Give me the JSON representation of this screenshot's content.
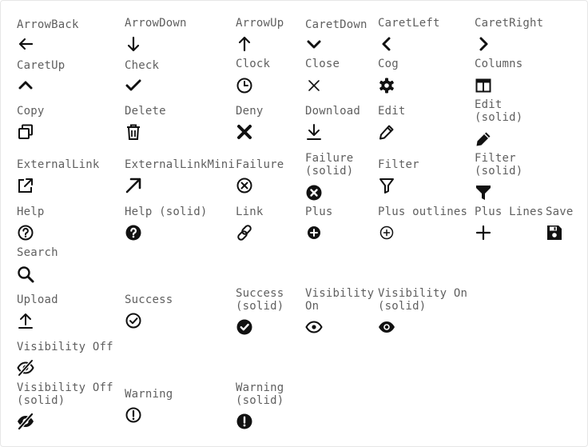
{
  "icons": [
    {
      "label": "ArrowBack",
      "icon": "arrow-back-icon"
    },
    {
      "label": "ArrowDown",
      "icon": "arrow-down-icon"
    },
    {
      "label": "ArrowUp",
      "icon": "arrow-up-icon"
    },
    {
      "label": "CaretDown",
      "icon": "caret-down-icon"
    },
    {
      "label": "CaretLeft",
      "icon": "caret-left-icon"
    },
    {
      "label": "CaretRight",
      "icon": "caret-right-icon"
    },
    {
      "label": "CaretUp",
      "icon": "caret-up-icon"
    },
    {
      "label": "Check",
      "icon": "check-icon"
    },
    {
      "label": "Clock",
      "icon": "clock-icon"
    },
    {
      "label": "Close",
      "icon": "close-icon"
    },
    {
      "label": "Cog",
      "icon": "cog-icon"
    },
    {
      "label": "Columns",
      "icon": "columns-icon"
    },
    {
      "label": "Copy",
      "icon": "copy-icon"
    },
    {
      "label": "Delete",
      "icon": "delete-icon"
    },
    {
      "label": "Deny",
      "icon": "deny-icon"
    },
    {
      "label": "Download",
      "icon": "download-icon"
    },
    {
      "label": "Edit",
      "icon": "edit-icon"
    },
    {
      "label": "Edit\n(solid)",
      "icon": "edit-solid-icon"
    },
    {
      "label": "ExternalLink",
      "icon": "external-link-icon"
    },
    {
      "label": "ExternalLinkMini",
      "icon": "external-link-mini-icon"
    },
    {
      "label": "Failure",
      "icon": "failure-icon"
    },
    {
      "label": "Failure\n(solid)",
      "icon": "failure-solid-icon"
    },
    {
      "label": "Filter",
      "icon": "filter-icon"
    },
    {
      "label": "Filter\n(solid)",
      "icon": "filter-solid-icon"
    },
    {
      "label": "Help",
      "icon": "help-icon"
    },
    {
      "label": "Help (solid)",
      "icon": "help-solid-icon"
    },
    {
      "label": "Link",
      "icon": "link-icon"
    },
    {
      "label": "Plus",
      "icon": "plus-icon"
    },
    {
      "label": "Plus outlines",
      "icon": "plus-outline-icon"
    },
    {
      "label": "Plus Lines",
      "icon": "plus-lines-icon"
    },
    {
      "label": "Save",
      "icon": "save-icon"
    },
    {
      "label": "Search",
      "icon": "search-icon"
    },
    {
      "label": "Upload",
      "icon": "upload-icon"
    },
    {
      "label": "Success",
      "icon": "success-icon"
    },
    {
      "label": "Success\n(solid)",
      "icon": "success-solid-icon"
    },
    {
      "label": "Visibility\nOn",
      "icon": "visibility-on-icon"
    },
    {
      "label": "Visibility On\n(solid)",
      "icon": "visibility-on-solid-icon"
    },
    {
      "label": "Visibility Off",
      "icon": "visibility-off-icon"
    },
    {
      "label": "Visibility Off\n(solid)",
      "icon": "visibility-off-solid-icon"
    },
    {
      "label": "Warning",
      "icon": "warning-icon"
    },
    {
      "label": "Warning\n(solid)",
      "icon": "warning-solid-icon"
    }
  ],
  "colors": {
    "label": "#5f5f5f",
    "icon": "#111111",
    "border": "#e6e6e6"
  }
}
